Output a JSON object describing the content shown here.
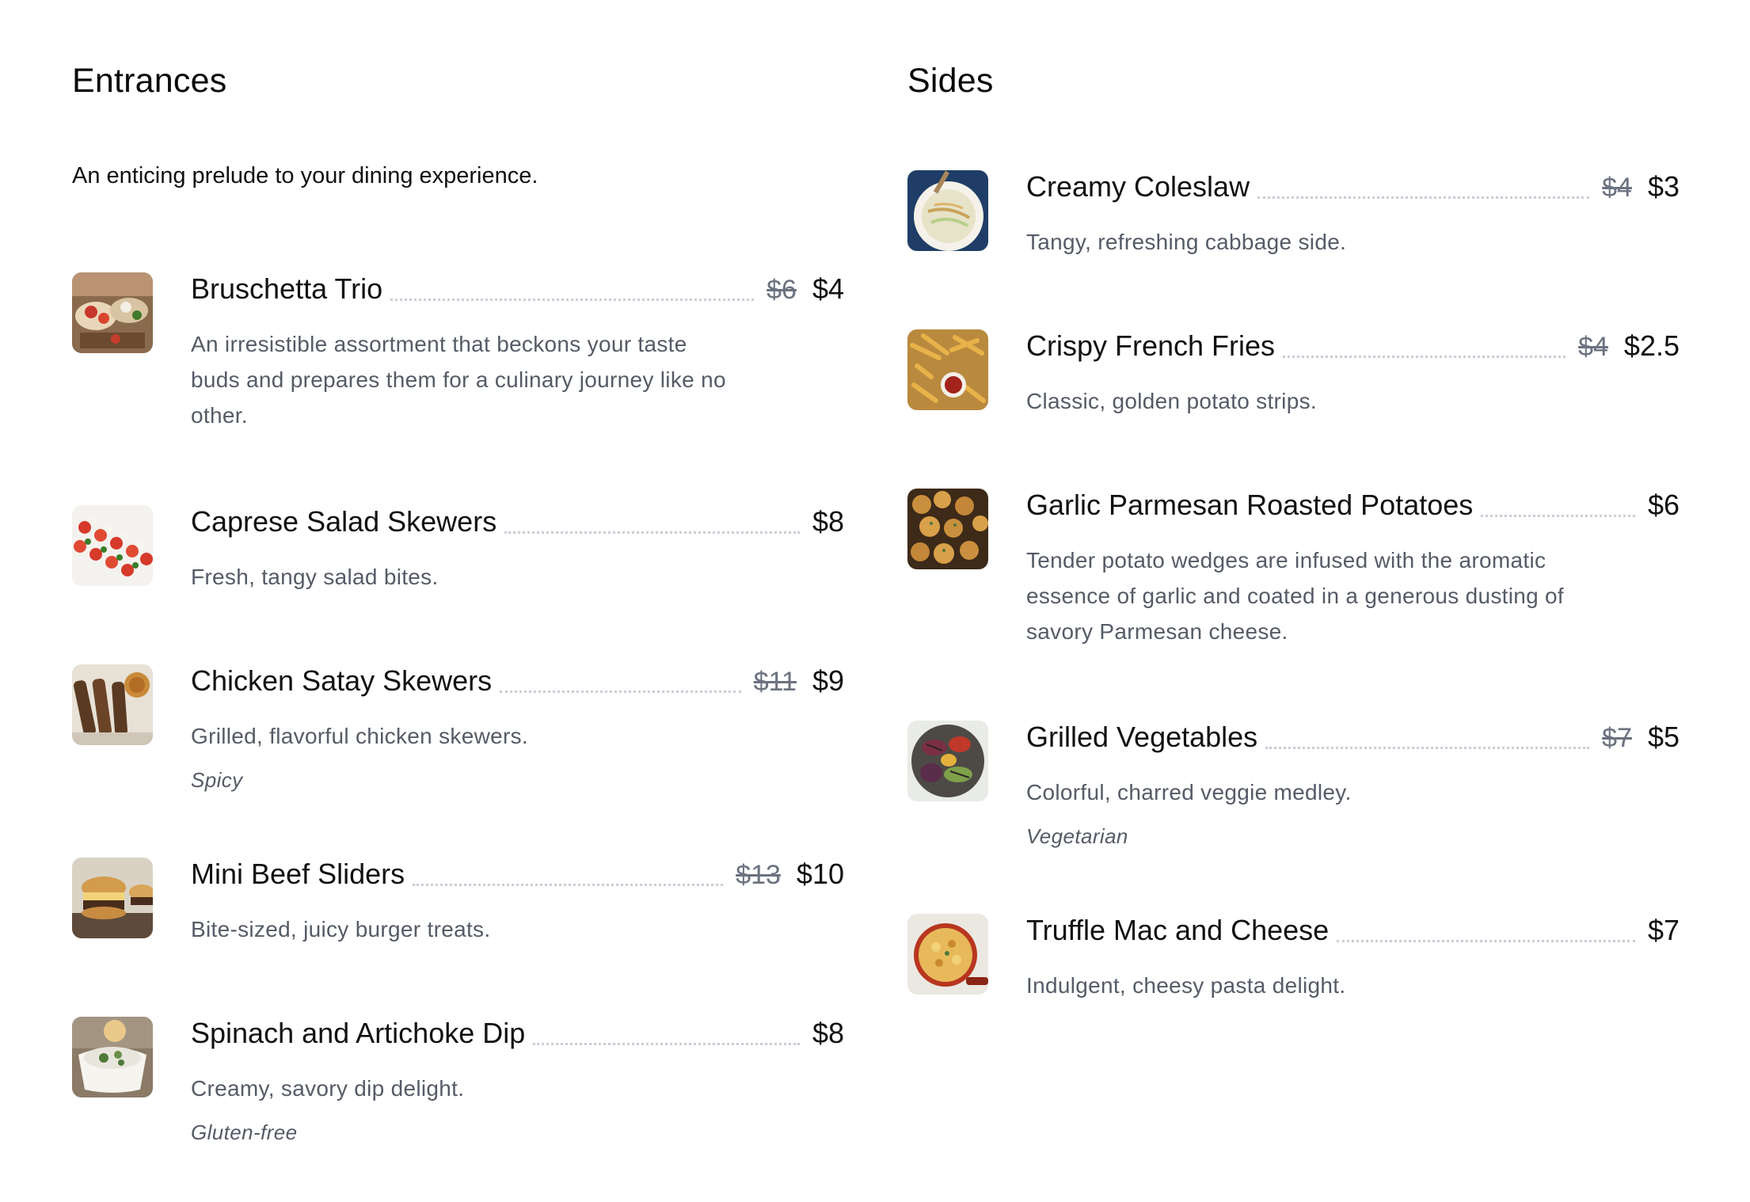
{
  "entrances": {
    "title": "Entrances",
    "intro": "An enticing prelude to your dining experience.",
    "items": [
      {
        "name": "Bruschetta Trio",
        "old_price": "$6",
        "price": "$4",
        "description": "An irresistible assortment that beckons your taste buds and prepares them for a culinary journey like no other.",
        "tag": "",
        "image": "bruschetta-thumb"
      },
      {
        "name": "Caprese Salad Skewers",
        "old_price": "",
        "price": "$8",
        "description": "Fresh, tangy salad bites.",
        "tag": "",
        "image": "caprese-thumb"
      },
      {
        "name": "Chicken Satay Skewers",
        "old_price": "$11",
        "price": "$9",
        "description": "Grilled, flavorful chicken skewers.",
        "tag": "Spicy",
        "image": "satay-thumb"
      },
      {
        "name": "Mini Beef Sliders",
        "old_price": "$13",
        "price": "$10",
        "description": "Bite-sized, juicy burger treats.",
        "tag": "",
        "image": "sliders-thumb"
      },
      {
        "name": "Spinach and Artichoke Dip",
        "old_price": "",
        "price": "$8",
        "description": "Creamy, savory dip delight.",
        "tag": "Gluten-free",
        "image": "dip-thumb"
      }
    ]
  },
  "sides": {
    "title": "Sides",
    "items": [
      {
        "name": "Creamy Coleslaw",
        "old_price": "$4",
        "price": "$3",
        "description": "Tangy, refreshing cabbage side.",
        "tag": "",
        "image": "coleslaw-thumb"
      },
      {
        "name": "Crispy French Fries",
        "old_price": "$4",
        "price": "$2.5",
        "description": "Classic, golden potato strips.",
        "tag": "",
        "image": "fries-thumb"
      },
      {
        "name": "Garlic Parmesan Roasted Potatoes",
        "old_price": "",
        "price": "$6",
        "description": "Tender potato wedges are infused with the aromatic essence of garlic and coated in a generous dusting of savory Parmesan cheese.",
        "tag": "",
        "image": "potatoes-thumb"
      },
      {
        "name": "Grilled Vegetables",
        "old_price": "$7",
        "price": "$5",
        "description": "Colorful, charred veggie medley.",
        "tag": "Vegetarian",
        "image": "vegetables-thumb"
      },
      {
        "name": "Truffle Mac and Cheese",
        "old_price": "",
        "price": "$7",
        "description": "Indulgent, cheesy pasta delight.",
        "tag": "",
        "image": "mac-cheese-thumb"
      }
    ]
  }
}
